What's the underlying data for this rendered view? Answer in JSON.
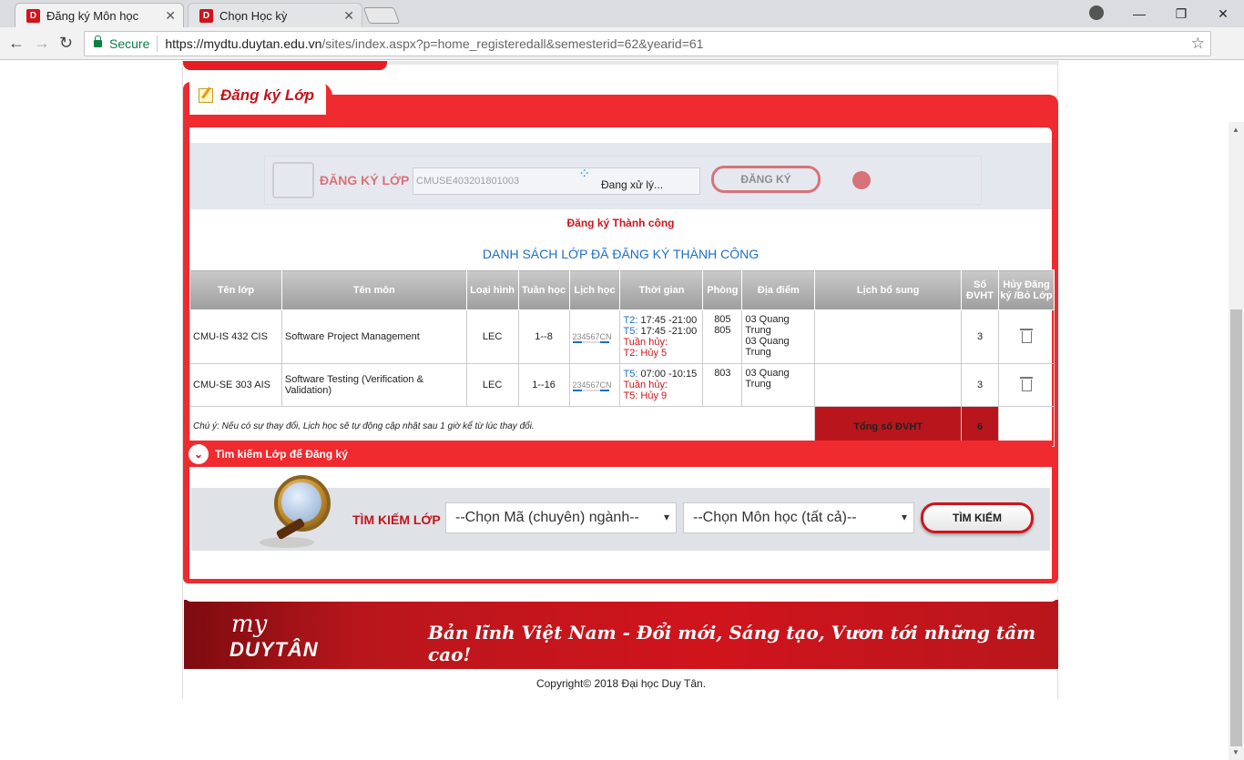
{
  "browser": {
    "tabs": [
      {
        "title": "Đăng ký Môn học",
        "active": true
      },
      {
        "title": "Chọn Học kỳ",
        "active": false
      }
    ],
    "secure_label": "Secure",
    "url_domain": "https://mydtu.duytan.edu.vn",
    "url_path": "/sites/index.aspx?p=home_registeredall&semesterid=62&yearid=61",
    "window_controls": {
      "minimize": "—",
      "restore": "❐",
      "close": "✕"
    }
  },
  "panel": {
    "title": "Đăng ký Lớp",
    "register": {
      "label": "ĐĂNG KÝ LỚP",
      "input_value": "CMUSE403201801003",
      "button": "ĐĂNG KÝ",
      "processing": "Đang xử lý..."
    },
    "success_message": "Đăng ký Thành công",
    "list_title": "DANH SÁCH LỚP ĐÃ ĐĂNG KÝ THÀNH CÔNG",
    "table": {
      "headers": [
        "Tên lớp",
        "Tên môn",
        "Loại hình",
        "Tuần học",
        "Lịch học",
        "Thời gian",
        "Phòng",
        "Địa điểm",
        "Lịch bổ sung",
        "Số ĐVHT",
        "Hủy Đăng ký /Bỏ Lớp"
      ],
      "rows": [
        {
          "class": "CMU-IS 432 CIS",
          "subject": "Software Project Management",
          "type": "LEC",
          "weeks": "1--8",
          "schedule": "234567CN",
          "time_lines": [
            {
              "day": "T2:",
              "time": " 17:45 -21:00"
            },
            {
              "day": "T5:",
              "time": " 17:45 -21:00"
            }
          ],
          "cancel_label": "Tuần hủy:",
          "cancel_value": "T2: Hủy 5",
          "room": "805\n805",
          "location": "03 Quang Trung\n03 Quang Trung",
          "extra": "",
          "credits": "3"
        },
        {
          "class": "CMU-SE 303 AIS",
          "subject": "Software Testing (Verification & Validation)",
          "type": "LEC",
          "weeks": "1--16",
          "schedule": "234567CN",
          "time_lines": [
            {
              "day": "T5:",
              "time": " 07:00 -10:15"
            }
          ],
          "cancel_label": "Tuần hủy:",
          "cancel_value": "T5: Hủy 9",
          "room": "803",
          "location": "03 Quang Trung",
          "extra": "",
          "credits": "3"
        }
      ],
      "note": "Chú ý: Nếu có sự thay đổi, Lịch học sẽ tự động cập nhật sau 1 giờ kể từ lúc thay đổi.",
      "total_label": "Tổng số ĐVHT",
      "total_value": "6"
    },
    "search": {
      "header": "Tìm kiếm Lớp để Đăng ký",
      "label": "TÌM KIẾM LỚP",
      "major_select": "--Chọn Mã (chuyên) ngành--",
      "subject_select": "--Chọn Môn học (tất cả)--",
      "button": "TÌM KIẾM"
    }
  },
  "footer": {
    "logo_my": "my",
    "logo_name": "DUYTÂN",
    "slogan": "Bản lĩnh Việt Nam - Đổi mới, Sáng tạo, Vươn tới những tầm cao!",
    "copyright": "Copyright© 2018 Đại học Duy Tân."
  },
  "colors": {
    "brand_red": "#ef2b2f",
    "link_blue": "#1e6fc4",
    "secure_green": "#0b8043"
  }
}
